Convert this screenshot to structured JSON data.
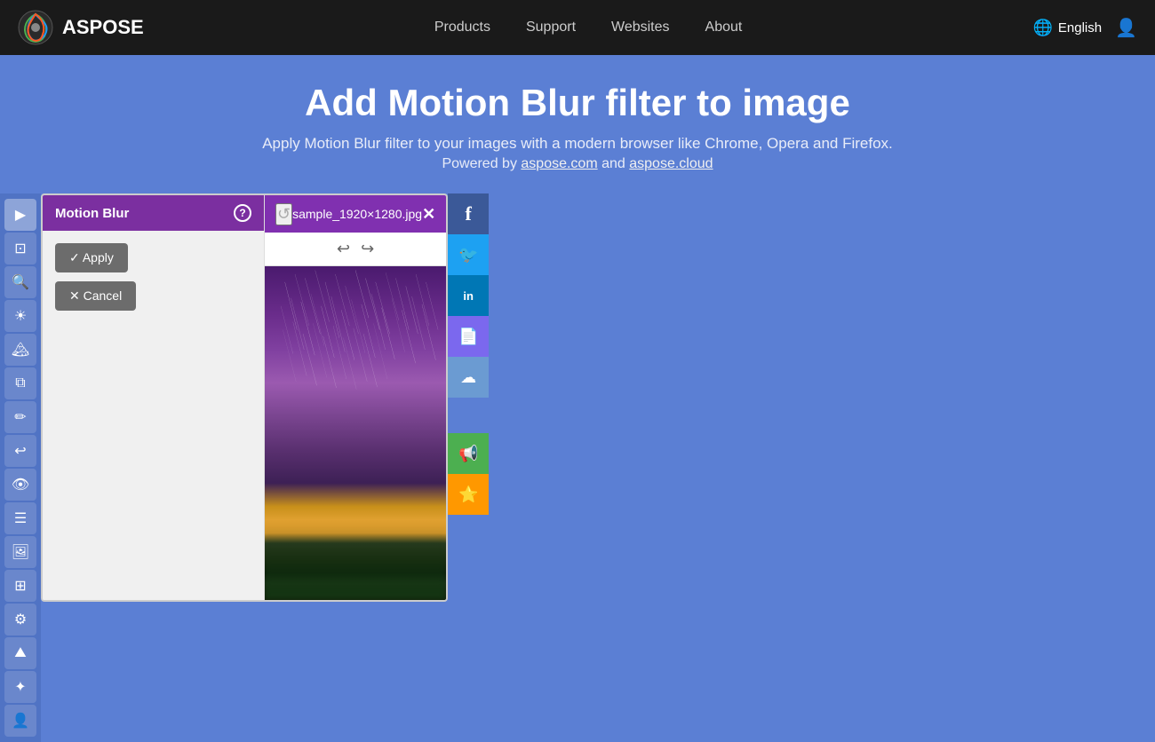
{
  "navbar": {
    "brand": "ASPOSE",
    "nav_items": [
      {
        "label": "Products",
        "id": "products"
      },
      {
        "label": "Support",
        "id": "support"
      },
      {
        "label": "Websites",
        "id": "websites"
      },
      {
        "label": "About",
        "id": "about"
      }
    ],
    "language": "English",
    "language_icon": "🌐"
  },
  "hero": {
    "title": "Add Motion Blur filter to image",
    "subtitle": "Apply Motion Blur filter to your images with a modern browser like Chrome, Opera and Firefox.",
    "powered_prefix": "Powered by ",
    "powered_link1": "aspose.com",
    "powered_and": " and ",
    "powered_link2": "aspose.cloud"
  },
  "filter_panel": {
    "title": "Motion Blur",
    "help_label": "?",
    "apply_label": "✓ Apply",
    "cancel_label": "✕ Cancel"
  },
  "image_viewer": {
    "filename": "sample_1920×1280.jpg",
    "close_label": "✕"
  },
  "social": [
    {
      "id": "facebook",
      "icon": "f",
      "label": "Facebook"
    },
    {
      "id": "twitter",
      "icon": "t",
      "label": "Twitter"
    },
    {
      "id": "linkedin",
      "icon": "in",
      "label": "LinkedIn"
    },
    {
      "id": "file-share",
      "icon": "📄",
      "label": "File Share"
    },
    {
      "id": "cloud",
      "icon": "☁",
      "label": "Cloud"
    }
  ],
  "tools": [
    {
      "id": "arrow-right",
      "icon": "▶",
      "label": "Next"
    },
    {
      "id": "crop",
      "icon": "⊡",
      "label": "Crop"
    },
    {
      "id": "zoom",
      "icon": "🔍",
      "label": "Zoom"
    },
    {
      "id": "brightness",
      "icon": "☀",
      "label": "Brightness"
    },
    {
      "id": "landscape",
      "icon": "🏞",
      "label": "Landscape"
    },
    {
      "id": "layers",
      "icon": "⧉",
      "label": "Layers"
    },
    {
      "id": "draw",
      "icon": "✏",
      "label": "Draw"
    },
    {
      "id": "undo",
      "icon": "↩",
      "label": "Undo"
    },
    {
      "id": "eye",
      "icon": "👁",
      "label": "Preview"
    },
    {
      "id": "list",
      "icon": "☰",
      "label": "List"
    },
    {
      "id": "gallery",
      "icon": "🖼",
      "label": "Gallery"
    },
    {
      "id": "grid",
      "icon": "⊞",
      "label": "Grid"
    },
    {
      "id": "settings",
      "icon": "⚙",
      "label": "Settings"
    },
    {
      "id": "mountain",
      "icon": "⛰",
      "label": "Mountain"
    },
    {
      "id": "effects",
      "icon": "✦",
      "label": "Effects"
    },
    {
      "id": "person",
      "icon": "👤",
      "label": "Person"
    }
  ]
}
